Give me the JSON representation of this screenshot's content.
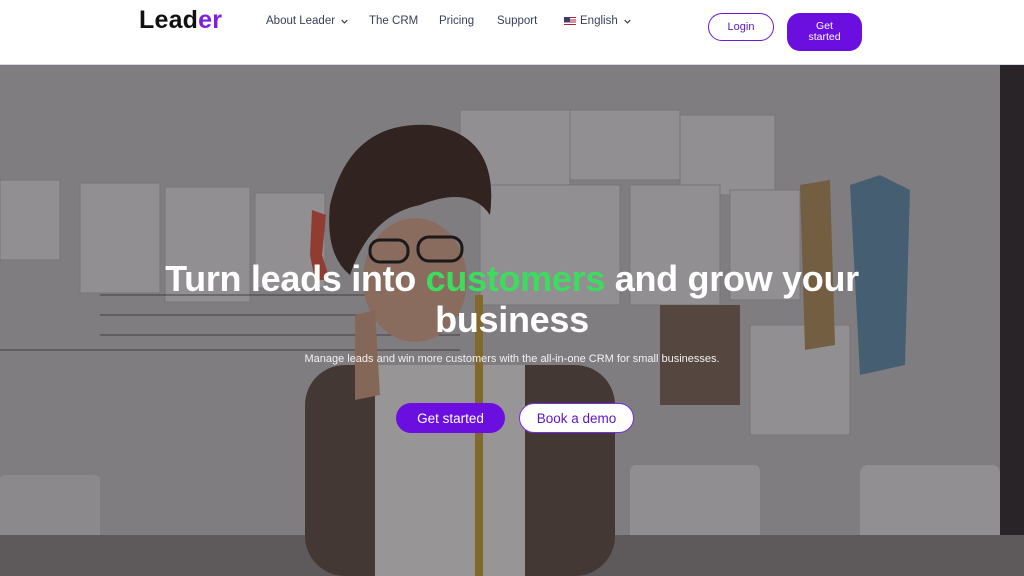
{
  "brand": {
    "logo_main": "Lead",
    "logo_accent": "er",
    "accent_color": "#6a0fe0"
  },
  "nav": {
    "items": [
      {
        "label": "About Leader",
        "has_dropdown": true
      },
      {
        "label": "The CRM"
      },
      {
        "label": "Pricing"
      },
      {
        "label": "Support"
      },
      {
        "label": "English",
        "has_dropdown": true,
        "icon": "us-flag-icon"
      }
    ]
  },
  "header_actions": {
    "login": "Login",
    "get_started_line1": "Get",
    "get_started_line2": "started"
  },
  "hero": {
    "headline_pre": "Turn leads into",
    "headline_highlight": "customers",
    "headline_post": "and grow your business",
    "highlight_color": "#3ddc5f",
    "subtitle": "Manage leads and win more customers with the all-in-one CRM for small businesses.",
    "cta_primary": "Get started",
    "cta_secondary": "Book a demo"
  }
}
